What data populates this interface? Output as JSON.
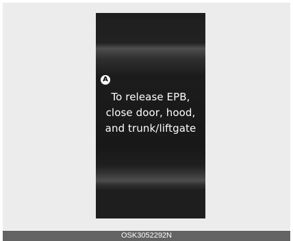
{
  "display": {
    "marker": "A",
    "message_lines": [
      "To release EPB,",
      "close door, hood,",
      "and trunk/liftgate"
    ]
  },
  "footer": {
    "code": "OSK3052292N"
  }
}
